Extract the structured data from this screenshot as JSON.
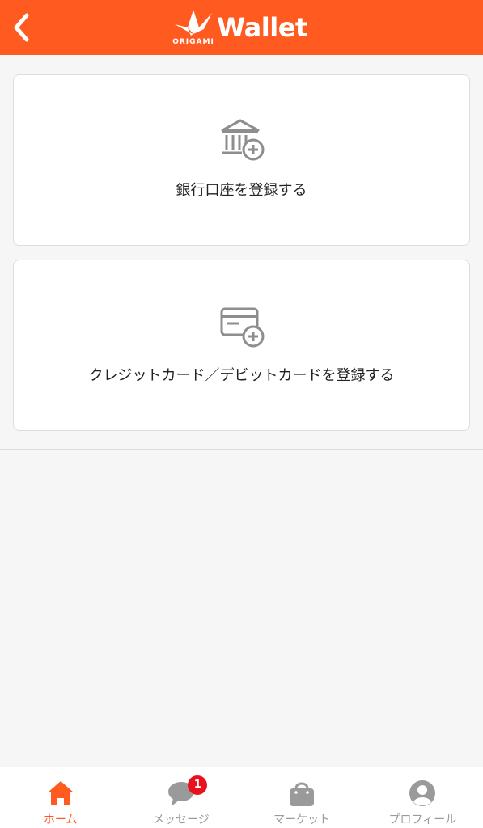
{
  "header": {
    "brand_sub": "ORIGAMI",
    "title": "Wallet",
    "back_icon": "chevron-left-icon"
  },
  "cards": [
    {
      "label": "銀行口座を登録する",
      "icon": "bank-plus-icon"
    },
    {
      "label": "クレジットカード／デビットカードを登録する",
      "icon": "card-plus-icon"
    }
  ],
  "tabbar": {
    "tabs": [
      {
        "label": "ホーム",
        "icon": "home-icon",
        "active": true
      },
      {
        "label": "メッセージ",
        "icon": "chat-bubble-icon",
        "badge": "1"
      },
      {
        "label": "マーケット",
        "icon": "shopping-bag-icon"
      },
      {
        "label": "プロフィール",
        "icon": "profile-icon"
      }
    ]
  },
  "colors": {
    "accent": "#ff5a1f",
    "badge": "#e8121e",
    "icon_gray": "#8e8e8e",
    "background": "#f6f6f6"
  }
}
